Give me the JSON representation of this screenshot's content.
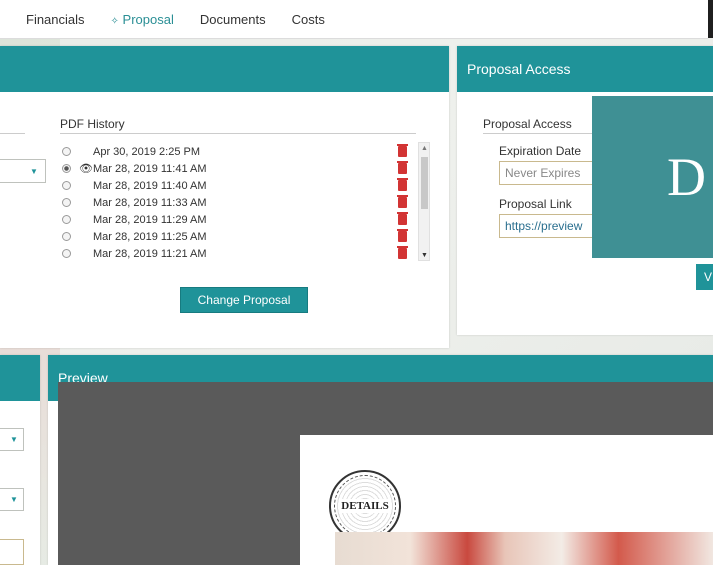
{
  "nav": {
    "tabs": [
      {
        "label": "Financials"
      },
      {
        "label": "Proposal",
        "icon": "leaf-icon",
        "active": true
      },
      {
        "label": "Documents"
      },
      {
        "label": "Costs"
      }
    ]
  },
  "pdf_panel": {
    "history_title": "PDF History",
    "rows": [
      {
        "date": "Apr 30, 2019 2:25 PM",
        "selected": false,
        "viewing": false
      },
      {
        "date": "Mar 28, 2019 11:41 AM",
        "selected": true,
        "viewing": true
      },
      {
        "date": "Mar 28, 2019 11:40 AM",
        "selected": false,
        "viewing": false
      },
      {
        "date": "Mar 28, 2019 11:33 AM",
        "selected": false,
        "viewing": false
      },
      {
        "date": "Mar 28, 2019 11:29 AM",
        "selected": false,
        "viewing": false
      },
      {
        "date": "Mar 28, 2019 11:25 AM",
        "selected": false,
        "viewing": false
      },
      {
        "date": "Mar 28, 2019 11:21 AM",
        "selected": false,
        "viewing": false
      }
    ],
    "change_button": "Change Proposal"
  },
  "access_panel": {
    "header": "Proposal Access",
    "section": "Proposal Access",
    "expiration_label": "Expiration Date",
    "expiration_value": "Never Expires",
    "link_label": "Proposal Link",
    "link_value": "https://preview",
    "overlay_letter": "D",
    "partial_button": "V"
  },
  "preview_panel": {
    "header": "Preview",
    "logo_text": "DETAILS"
  },
  "colors": {
    "accent": "#1f9399",
    "trash": "#d23434",
    "overlay": "#3f9094"
  }
}
